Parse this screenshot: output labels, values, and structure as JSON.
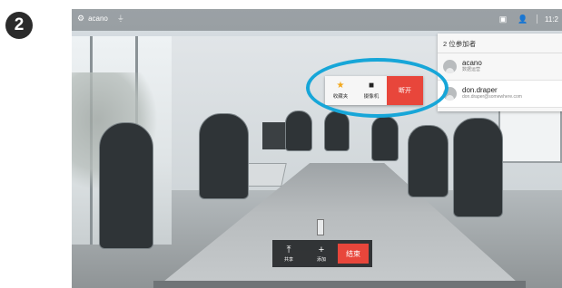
{
  "step": {
    "number": "2"
  },
  "header": {
    "app_name": "acano",
    "time": "11:2"
  },
  "participants_panel": {
    "title": "2 位参加者",
    "items": [
      {
        "name": "acano",
        "subtitle": "数据运营"
      },
      {
        "name": "don.draper",
        "subtitle": "don.draper@somewhere.com"
      }
    ]
  },
  "popup": {
    "favorite_label": "收藏夹",
    "camera_label": "摄像机",
    "disconnect_label": "断开"
  },
  "controls": {
    "share_label": "共享",
    "add_label": "添加",
    "end_label": "结束"
  },
  "colors": {
    "accent": "#17a6d8",
    "danger": "#e8463b",
    "favorite": "#f3a81c"
  }
}
